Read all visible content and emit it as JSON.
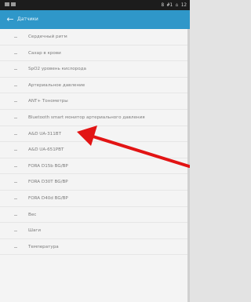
{
  "status_bar": {
    "right_text": "8 #1 ⌂ 12"
  },
  "app_bar": {
    "title": "Датчики"
  },
  "list": {
    "items": [
      {
        "label": "Сердечный ритм"
      },
      {
        "label": "Сахар в крови"
      },
      {
        "label": "SpO2 уровень кислорода"
      },
      {
        "label": "Артериальное давление"
      },
      {
        "label": "ANT+ Тонометры"
      },
      {
        "label": "Bluetooth smart монитор артериального давления"
      },
      {
        "label": "A&D UA-311BT"
      },
      {
        "label": "A&D UA-651PBT"
      },
      {
        "label": "FORA D15b BG/BP"
      },
      {
        "label": "FORA D30T BG/BP"
      },
      {
        "label": "FORA D40d BG/BP"
      },
      {
        "label": "Вес"
      },
      {
        "label": "Шаги"
      },
      {
        "label": "Температура"
      }
    ]
  },
  "colors": {
    "app_bar": "#2f97c9",
    "status_bar": "#1c1c1c",
    "annotation_arrow": "#e21414"
  }
}
